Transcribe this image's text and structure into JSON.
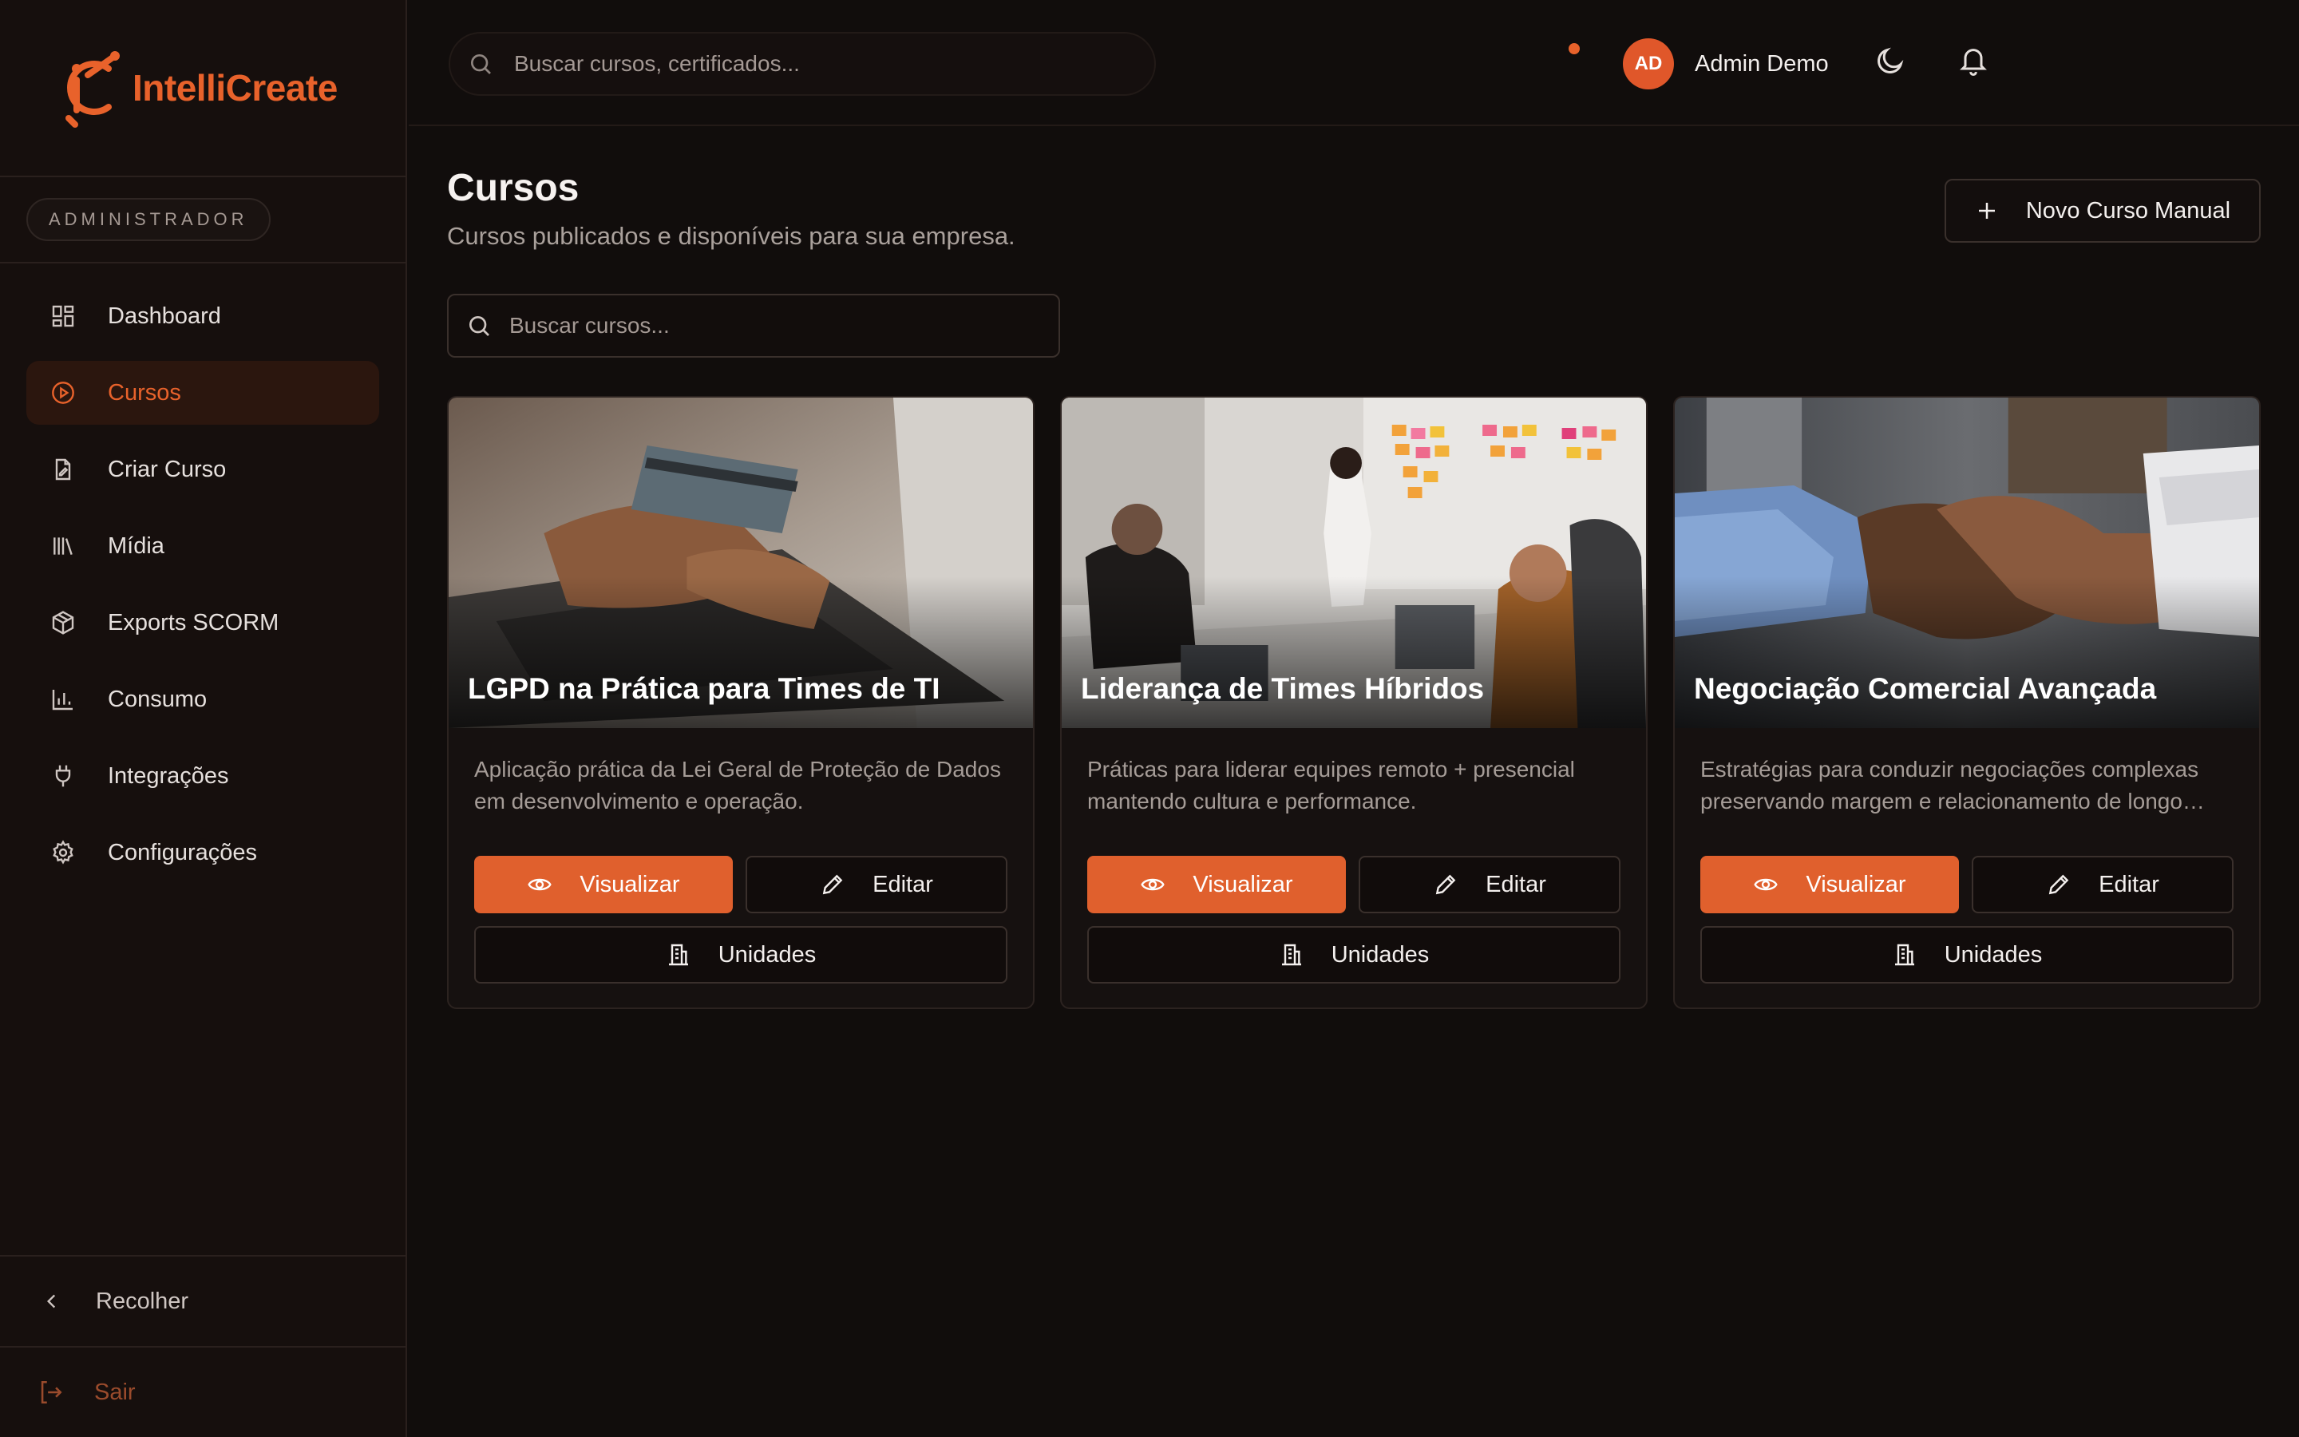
{
  "brand": {
    "name": "IntelliCreate",
    "accent": "#e8622b"
  },
  "role_badge": "ADMINISTRADOR",
  "sidebar": {
    "items": [
      {
        "label": "Dashboard",
        "icon": "dashboard-icon"
      },
      {
        "label": "Cursos",
        "icon": "play-circle-icon",
        "active": true
      },
      {
        "label": "Criar Curso",
        "icon": "file-edit-icon"
      },
      {
        "label": "Mídia",
        "icon": "library-icon"
      },
      {
        "label": "Exports SCORM",
        "icon": "package-icon"
      },
      {
        "label": "Consumo",
        "icon": "bar-chart-icon"
      },
      {
        "label": "Integrações",
        "icon": "plug-icon"
      },
      {
        "label": "Configurações",
        "icon": "gear-icon"
      }
    ],
    "collapse_label": "Recolher",
    "logout_label": "Sair"
  },
  "topbar": {
    "search_placeholder": "Buscar cursos, certificados...",
    "user": {
      "initials": "AD",
      "name": "Admin Demo"
    }
  },
  "page": {
    "title": "Cursos",
    "subtitle": "Cursos publicados e disponíveis para sua empresa.",
    "new_course_label": "Novo Curso Manual",
    "search_placeholder": "Buscar cursos..."
  },
  "courses": [
    {
      "title": "LGPD na Prática para Times de TI",
      "description": "Aplicação prática da Lei Geral de Proteção de Dados em desenvolvimento e operação.",
      "view_label": "Visualizar",
      "edit_label": "Editar",
      "units_label": "Unidades"
    },
    {
      "title": "Liderança de Times Híbridos",
      "description": "Práticas para liderar equipes remoto + presencial mantendo cultura e performance.",
      "view_label": "Visualizar",
      "edit_label": "Editar",
      "units_label": "Unidades"
    },
    {
      "title": "Negociação Comercial Avançada",
      "description": "Estratégias para conduzir negociações complexas preservando margem e relacionamento de longo prazo.",
      "view_label": "Visualizar",
      "edit_label": "Editar",
      "units_label": "Unidades"
    }
  ]
}
